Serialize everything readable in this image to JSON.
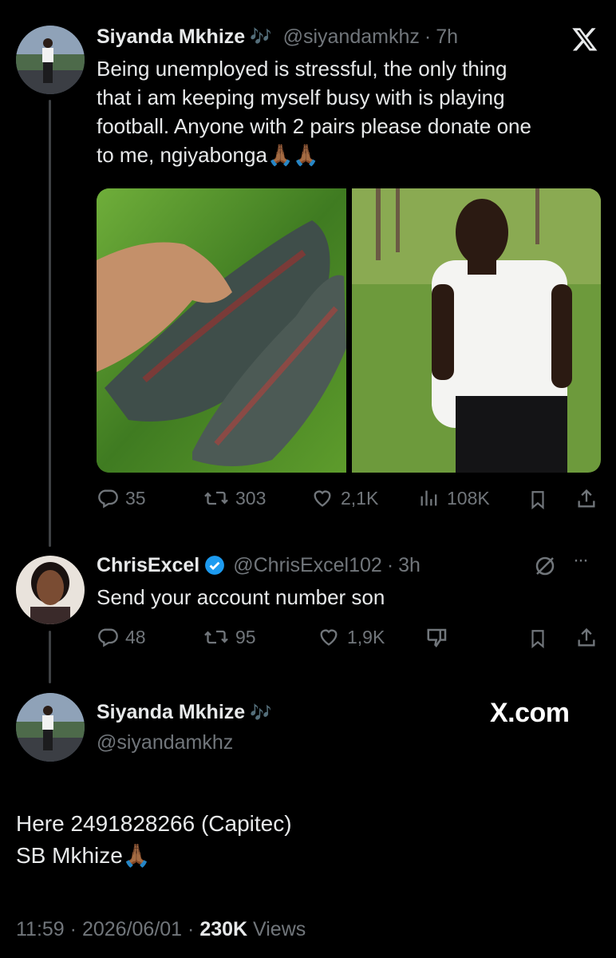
{
  "tweet1": {
    "name": "Siyanda Mkhize",
    "name_emoji": "🎶",
    "handle": "@siyandamkhz",
    "separator": "·",
    "time": "7h",
    "lines": [
      "Being unemployed is stressful, the only thing",
      "that i am keeping myself busy with is playing",
      "football. Anyone with 2 pairs please donate one",
      "to me, ngiyabonga"
    ],
    "emoji_tail": "🙏🏾🙏🏾",
    "stats": {
      "replies": "35",
      "reposts": "303",
      "likes": "2,1K",
      "views": "108K"
    }
  },
  "reply": {
    "name": "ChrisExcel",
    "handle": "@ChrisExcel102",
    "separator": "·",
    "time": "3h",
    "text": "Send your account number son",
    "more": "···",
    "stats": {
      "replies": "48",
      "reposts": "95",
      "likes": "1,9K"
    }
  },
  "tweet3": {
    "name": "Siyanda Mkhize",
    "name_emoji": "🎶",
    "handle": "@siyandamkhz",
    "line1": "Here  2491828266 (Capitec)",
    "line2": "SB Mkhize",
    "line2_emoji": "🙏🏾",
    "time": "11:59",
    "sep": "·",
    "date": "2026/06/01",
    "sep2": "·",
    "views_count": "230K",
    "views_label": "Views"
  },
  "watermark": "X.com",
  "brand_logo": "X",
  "colors": {
    "background": "#000000",
    "text": "#e7e9ea",
    "muted": "#71767b",
    "verified": "#1d9bf0"
  }
}
